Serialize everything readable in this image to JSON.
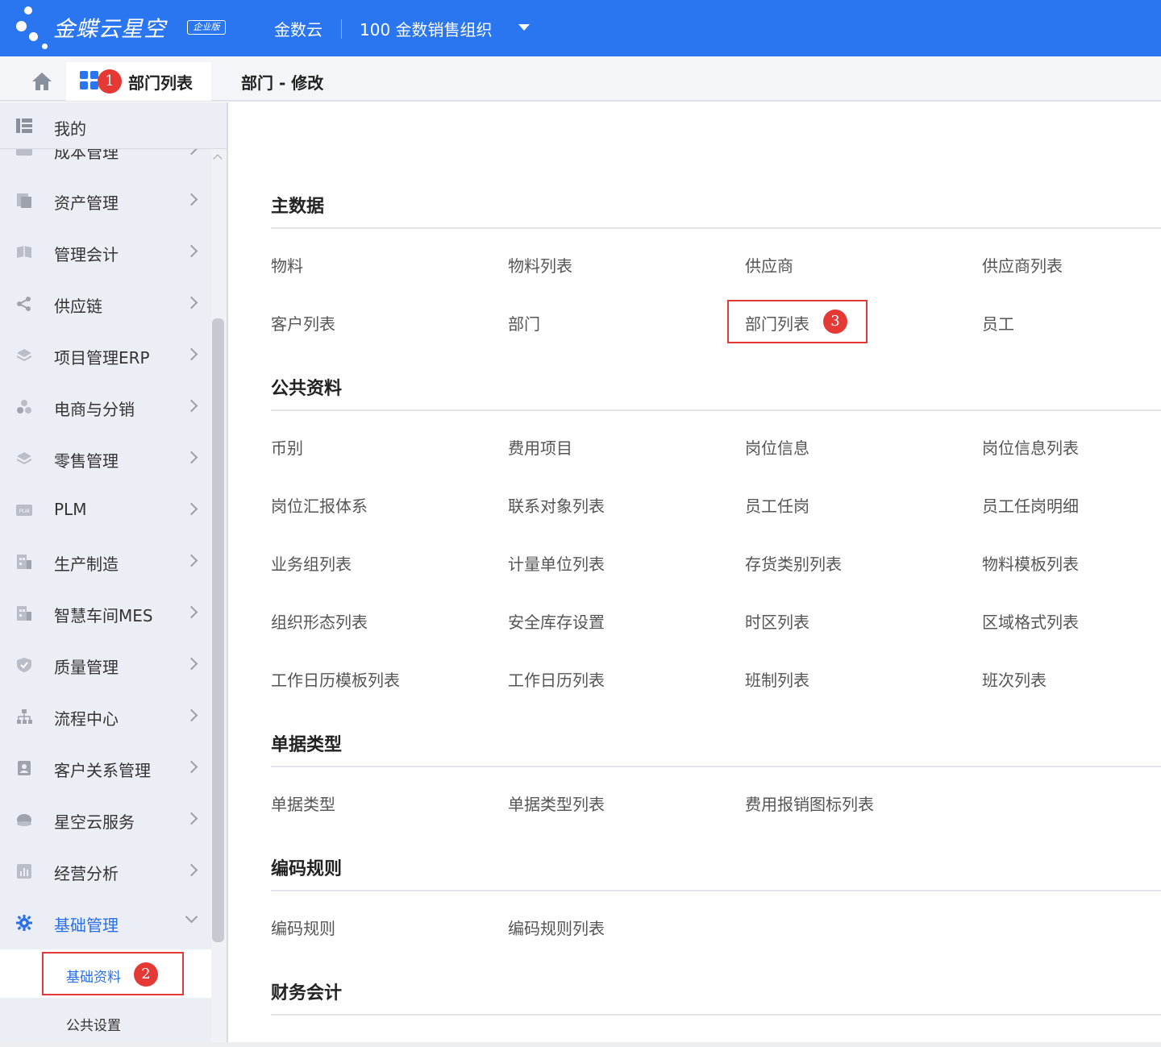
{
  "header": {
    "logo_text": "金蝶云星空",
    "logo_badge": "企业版",
    "tenant": "金数云",
    "org": "100  金数销售组织"
  },
  "tabs": {
    "tab1_label": "部门列表",
    "tab1_badge": "1",
    "tab2_label": "部门 - 修改"
  },
  "sidebar": {
    "mine_label": "我的",
    "cut_item_label": "成本管理",
    "items": [
      {
        "label": "资产管理",
        "icon": "asset-icon"
      },
      {
        "label": "管理会计",
        "icon": "book-icon"
      },
      {
        "label": "供应链",
        "icon": "share-icon"
      },
      {
        "label": "项目管理ERP",
        "icon": "layers-icon"
      },
      {
        "label": "电商与分销",
        "icon": "cluster-icon"
      },
      {
        "label": "零售管理",
        "icon": "layers-icon"
      },
      {
        "label": "PLM",
        "icon": "plm-icon"
      },
      {
        "label": "生产制造",
        "icon": "building-icon"
      },
      {
        "label": "智慧车间MES",
        "icon": "building-icon"
      },
      {
        "label": "质量管理",
        "icon": "shield-icon"
      },
      {
        "label": "流程中心",
        "icon": "flow-icon"
      },
      {
        "label": "客户关系管理",
        "icon": "contact-icon"
      },
      {
        "label": "星空云服务",
        "icon": "cloud-icon"
      },
      {
        "label": "经营分析",
        "icon": "chart-icon"
      },
      {
        "label": "基础管理",
        "icon": "gear-icon",
        "active": true
      }
    ],
    "sub_active_label": "基础资料",
    "sub_active_badge": "2",
    "sub_label2": "公共设置"
  },
  "content": {
    "sections": [
      {
        "title": "主数据",
        "rows": [
          [
            "物料",
            "物料列表",
            "供应商",
            "供应商列表"
          ],
          [
            "客户列表",
            "部门",
            "部门列表",
            "员工"
          ]
        ]
      },
      {
        "title": "公共资料",
        "rows": [
          [
            "币别",
            "费用项目",
            "岗位信息",
            "岗位信息列表"
          ],
          [
            "岗位汇报体系",
            "联系对象列表",
            "员工任岗",
            "员工任岗明细"
          ],
          [
            "业务组列表",
            "计量单位列表",
            "存货类别列表",
            "物料模板列表"
          ],
          [
            "组织形态列表",
            "安全库存设置",
            "时区列表",
            "区域格式列表"
          ],
          [
            "工作日历模板列表",
            "工作日历列表",
            "班制列表",
            "班次列表"
          ]
        ]
      },
      {
        "title": "单据类型",
        "rows": [
          [
            "单据类型",
            "单据类型列表",
            "费用报销图标列表"
          ]
        ]
      },
      {
        "title": "编码规则",
        "rows": [
          [
            "编码规则",
            "编码规则列表"
          ]
        ]
      },
      {
        "title": "财务会计",
        "rows": []
      }
    ],
    "highlight_badge": "3"
  },
  "colors": {
    "primary": "#2a75f0",
    "badge_red": "#e53935",
    "active_text": "#2a6fe8"
  }
}
